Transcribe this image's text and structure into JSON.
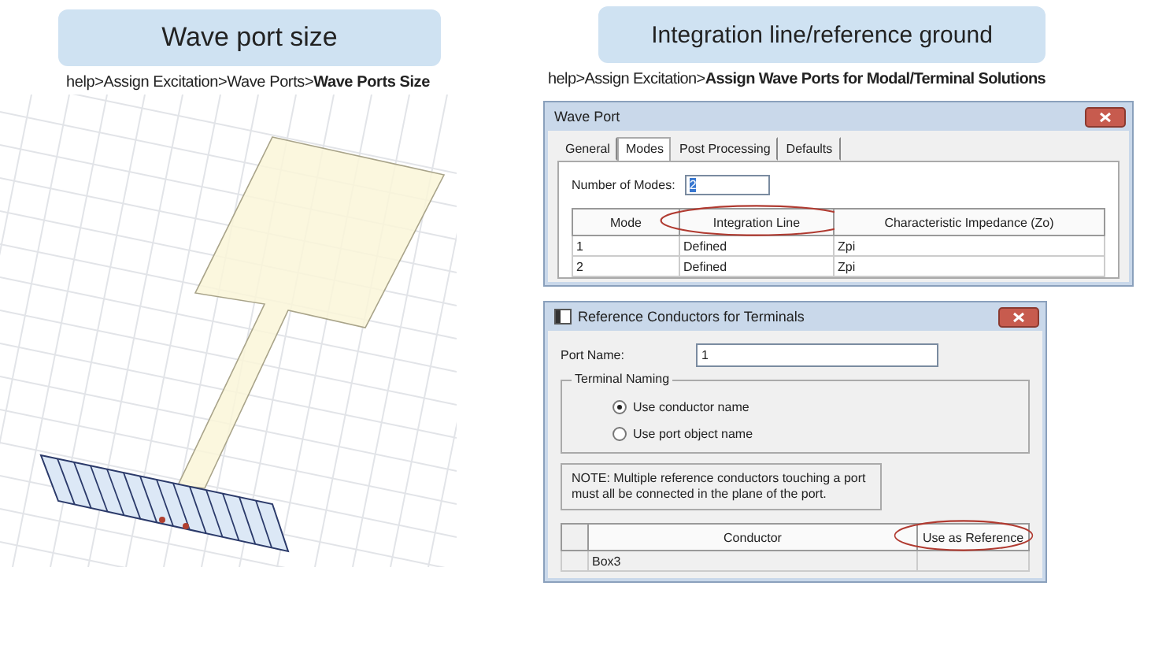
{
  "left_panel": {
    "title": "Wave port size",
    "menu_path": "help>Assign Excitation>Wave Ports>**Wave Ports Size**"
  },
  "right_panel": {
    "title": "Integration line/reference ground",
    "menu_path": "help>Assign Excitation>**Assign Wave Ports for Modal/Terminal Solutions**",
    "wave_port_dialog": {
      "title": "Wave Port",
      "tabs": [
        {
          "label": "General",
          "selected": false
        },
        {
          "label": "Modes",
          "selected": true
        },
        {
          "label": "Post Processing",
          "selected": false
        },
        {
          "label": "Defaults",
          "selected": false
        }
      ],
      "modes_label": "Number of Modes:",
      "modes_value": "2",
      "columns": [
        {
          "label": "Mode",
          "circled": false
        },
        {
          "label": "Integration Line",
          "circled": true
        },
        {
          "label": "Characteristic Impedance (Zo)",
          "circled": false
        }
      ],
      "rows": [
        [
          "1",
          "Defined",
          "Zpi"
        ],
        [
          "2",
          "Defined",
          "Zpi"
        ]
      ]
    },
    "reference_dialog": {
      "title": "Reference Conductors for Terminals",
      "port_name_label": "Port Name:",
      "port_name": "1",
      "naming_label": "Terminal Naming",
      "naming_options": [
        {
          "label": "Use conductor name",
          "selected": true
        },
        {
          "label": "Use port object name",
          "selected": false
        }
      ],
      "note": "NOTE: Multiple reference conductors touching a port must all be connected in the plane of the port.",
      "columns": [
        {
          "label": "Conductor",
          "circled": false
        },
        {
          "label": "Use as Reference",
          "circled": true
        }
      ],
      "rows": [
        [
          "Box3"
        ]
      ]
    }
  }
}
